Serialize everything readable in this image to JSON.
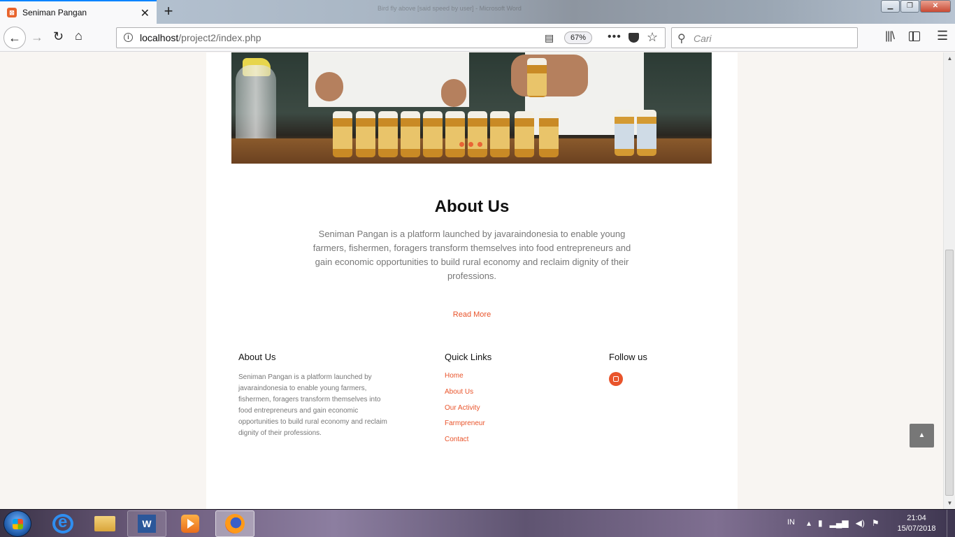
{
  "browser": {
    "tab_title": "Seniman Pangan",
    "tab_favicon": "xampp-favicon-icon",
    "url_host": "localhost",
    "url_path": "/project2/index.php",
    "zoom": "67%",
    "search_placeholder": "Cari",
    "window_title_faded": "Bird fly above [said speed by user] - Microsoft Word",
    "accent": "#0a84ff"
  },
  "page": {
    "about_title": "About Us",
    "about_text": "Seniman Pangan is a platform launched by javaraindonesia to enable young farmers, fishermen, foragers transform themselves into food entrepreneurs and gain economic opportunities to build rural economy and reclaim dignity of their professions.",
    "read_more": "Read More",
    "accent_color": "#e9542b",
    "footer": {
      "about_heading": "About Us",
      "about_text": "Seniman Pangan is a platform launched by javaraindonesia to enable young farmers, fishermen, foragers transform themselves into food entrepreneurs and gain economic opportunities to build rural economy and reclaim dignity of their professions.",
      "links_heading": "Quick Links",
      "links": [
        "Home",
        "About Us",
        "Our Activity",
        "Farmpreneur",
        "Contact"
      ],
      "follow_heading": "Follow us",
      "social_icon": "instagram-icon"
    },
    "back_to_top_icon": "chevron-up-icon"
  },
  "taskbar": {
    "apps": [
      "internet-explorer-icon",
      "file-explorer-icon",
      "microsoft-word-icon",
      "media-player-icon",
      "firefox-icon"
    ],
    "language": "IN",
    "time": "21:04",
    "date": "15/07/2018"
  }
}
